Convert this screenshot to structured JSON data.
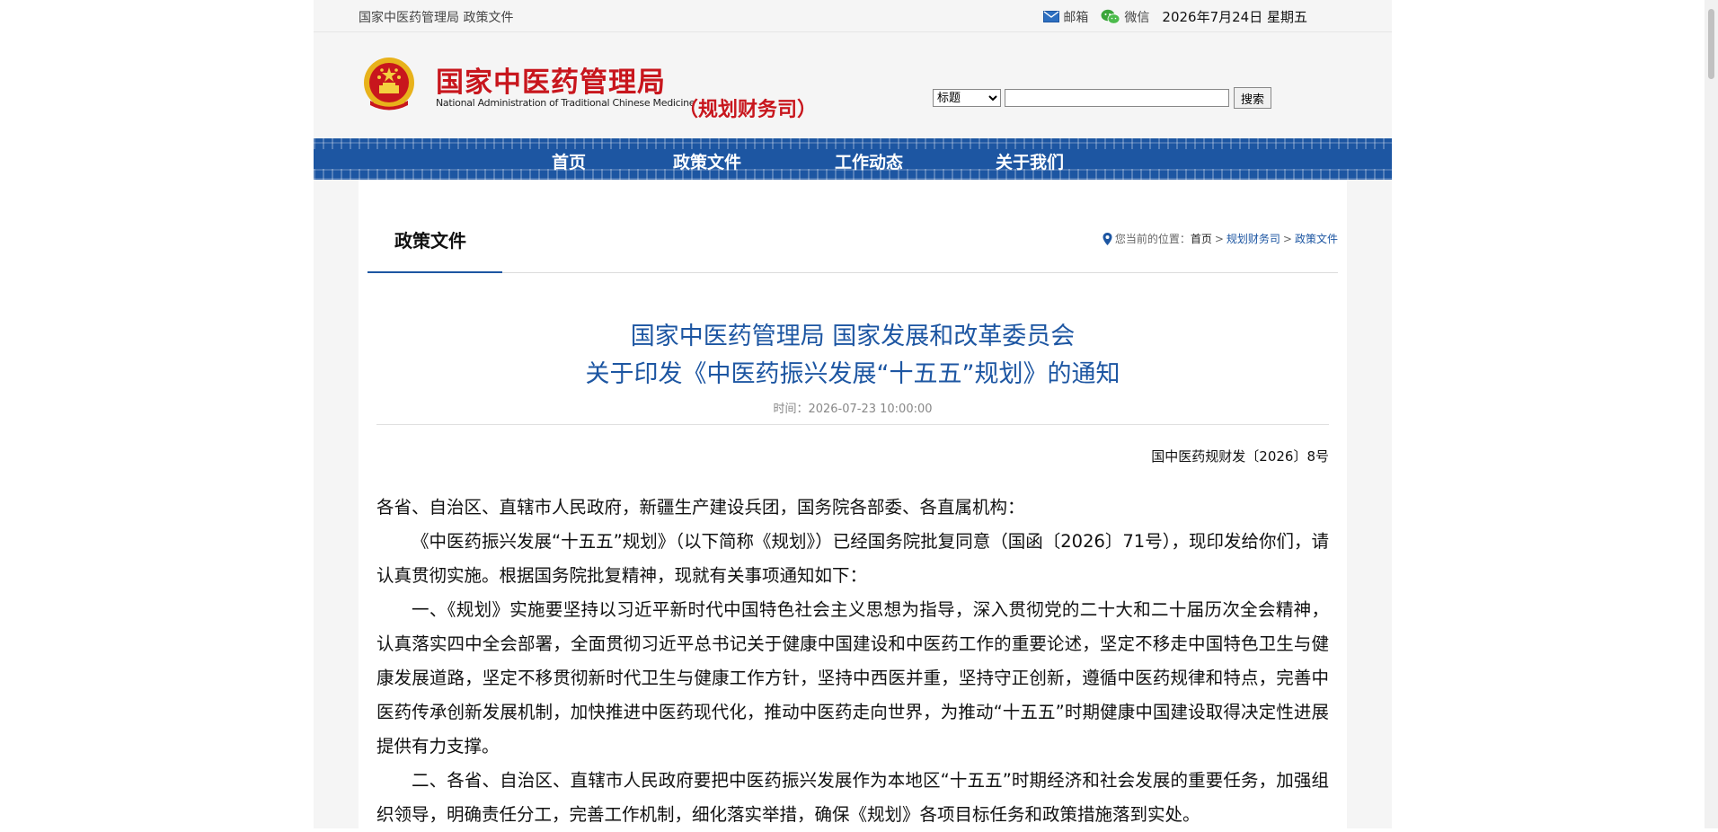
{
  "topbar": {
    "breadcrumb": "国家中医药管理局 政策文件",
    "mail_label": "邮箱",
    "wechat_label": "微信",
    "date": "2026年7月24日 星期五"
  },
  "header": {
    "org_name": "国家中医药管理局",
    "org_name_en": "National Administration of Traditional Chinese Medicine",
    "department": "（规划财务司）",
    "search": {
      "select_value": "标题",
      "input_value": "",
      "button_label": "搜索"
    }
  },
  "nav": {
    "items": [
      {
        "label": "首页"
      },
      {
        "label": "政策文件"
      },
      {
        "label": "工作动态"
      },
      {
        "label": "关于我们"
      }
    ]
  },
  "section": {
    "title": "政策文件",
    "location_label": "您当前的位置：",
    "location": [
      "首页",
      "规划财务司",
      "政策文件"
    ]
  },
  "article": {
    "title_line1": "国家中医药管理局 国家发展和改革委员会",
    "title_line2": "关于印发《中医药振兴发展“十五五”规划》的通知",
    "time": "时间：2026-07-23 10:00:00",
    "doc_number": "国中医药规财发〔2026〕8号",
    "paragraphs": [
      "各省、自治区、直辖市人民政府，新疆生产建设兵团，国务院各部委、各直属机构：",
      "《中医药振兴发展“十五五”规划》（以下简称《规划》）已经国务院批复同意（国函〔2026〕71号），现印发给你们，请认真贯彻实施。根据国务院批复精神，现就有关事项通知如下：",
      "一、《规划》实施要坚持以习近平新时代中国特色社会主义思想为指导，深入贯彻党的二十大和二十届历次全会精神，认真落实四中全会部署，全面贯彻习近平总书记关于健康中国建设和中医药工作的重要论述，坚定不移走中国特色卫生与健康发展道路，坚定不移贯彻新时代卫生与健康工作方针，坚持中西医并重，坚持守正创新，遵循中医药规律和特点，完善中医药传承创新发展机制，加快推进中医药现代化，推动中医药走向世界，为推动“十五五”时期健康中国建设取得决定性进展提供有力支撑。",
      "二、各省、自治区、直辖市人民政府要把中医药振兴发展作为本地区“十五五”时期经济和社会发展的重要任务，加强组织领导，明确责任分工，完善工作机制，细化落实举措，确保《规划》各项目标任务和政策措施落到实处。"
    ]
  },
  "colors": {
    "brand_red": "#c8161d",
    "brand_blue": "#1d56a2"
  }
}
